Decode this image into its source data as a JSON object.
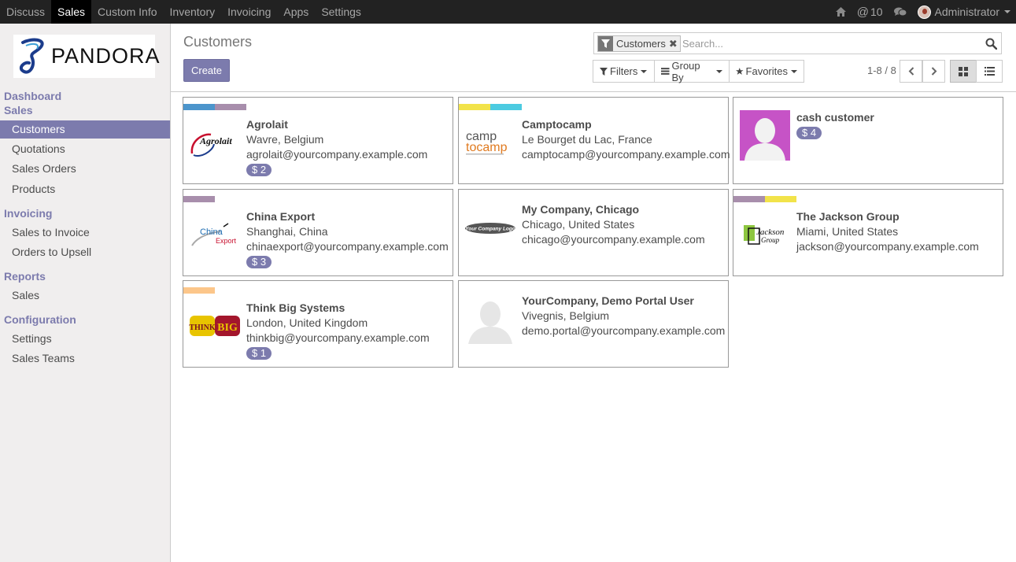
{
  "topbar": {
    "menu": [
      "Discuss",
      "Sales",
      "Custom Info",
      "Inventory",
      "Invoicing",
      "Apps",
      "Settings"
    ],
    "active_index": 1,
    "messages_count": "10",
    "user": "Administrator"
  },
  "sidebar": {
    "logo_text": "PANDORA",
    "sections": {
      "dashboard": "Dashboard",
      "sales": "Sales",
      "invoicing": "Invoicing",
      "reports": "Reports",
      "configuration": "Configuration"
    },
    "items": {
      "customers": "Customers",
      "quotations": "Quotations",
      "sales_orders": "Sales Orders",
      "products": "Products",
      "sales_to_invoice": "Sales to Invoice",
      "orders_to_upsell": "Orders to Upsell",
      "report_sales": "Sales",
      "settings": "Settings",
      "sales_teams": "Sales Teams"
    }
  },
  "control_panel": {
    "title": "Customers",
    "create_label": "Create",
    "facet_label": "Customers",
    "search_placeholder": "Search...",
    "filters_label": "Filters",
    "groupby_label": "Group By",
    "favorites_label": "Favorites",
    "pager": "1-8 / 8"
  },
  "colors": {
    "accent": "#7c7bad",
    "tag_blue": "#4c95cc",
    "tag_mauve": "#a88eac",
    "tag_yellow": "#f2e34a",
    "tag_cyan": "#4ccbe1",
    "tag_orange": "#fcc68a"
  },
  "customers": [
    {
      "name": "Agrolait",
      "location": "Wavre, Belgium",
      "email": "agrolait@yourcompany.example.com",
      "badge": "$ 2",
      "logo_text": "Agrolait"
    },
    {
      "name": "Camptocamp",
      "location": "Le Bourget du Lac, France",
      "email": "camptocamp@yourcompany.example.com",
      "badge": "",
      "logo_text_1": "camp",
      "logo_text_2": "tocamp"
    },
    {
      "name": "cash customer",
      "badge": "$ 4"
    },
    {
      "name": "China Export",
      "location": "Shanghai, China",
      "email": "chinaexport@yourcompany.example.com",
      "badge": "$ 3",
      "logo_text_1": "China",
      "logo_text_2": "Export"
    },
    {
      "name": "My Company, Chicago",
      "location": "Chicago, United States",
      "email": "chicago@yourcompany.example.com",
      "logo_text": "Your Company Logo"
    },
    {
      "name": "The Jackson Group",
      "location": "Miami, United States",
      "email": "jackson@yourcompany.example.com",
      "logo_text_1": "Jackson",
      "logo_text_2": "Group"
    },
    {
      "name": "Think Big Systems",
      "location": "London, United Kingdom",
      "email": "thinkbig@yourcompany.example.com",
      "badge": "$ 1",
      "logo_text_1": "THINK",
      "logo_text_2": "BIG"
    },
    {
      "name": "YourCompany, Demo Portal User",
      "location": "Vivegnis, Belgium",
      "email": "demo.portal@yourcompany.example.com"
    }
  ]
}
